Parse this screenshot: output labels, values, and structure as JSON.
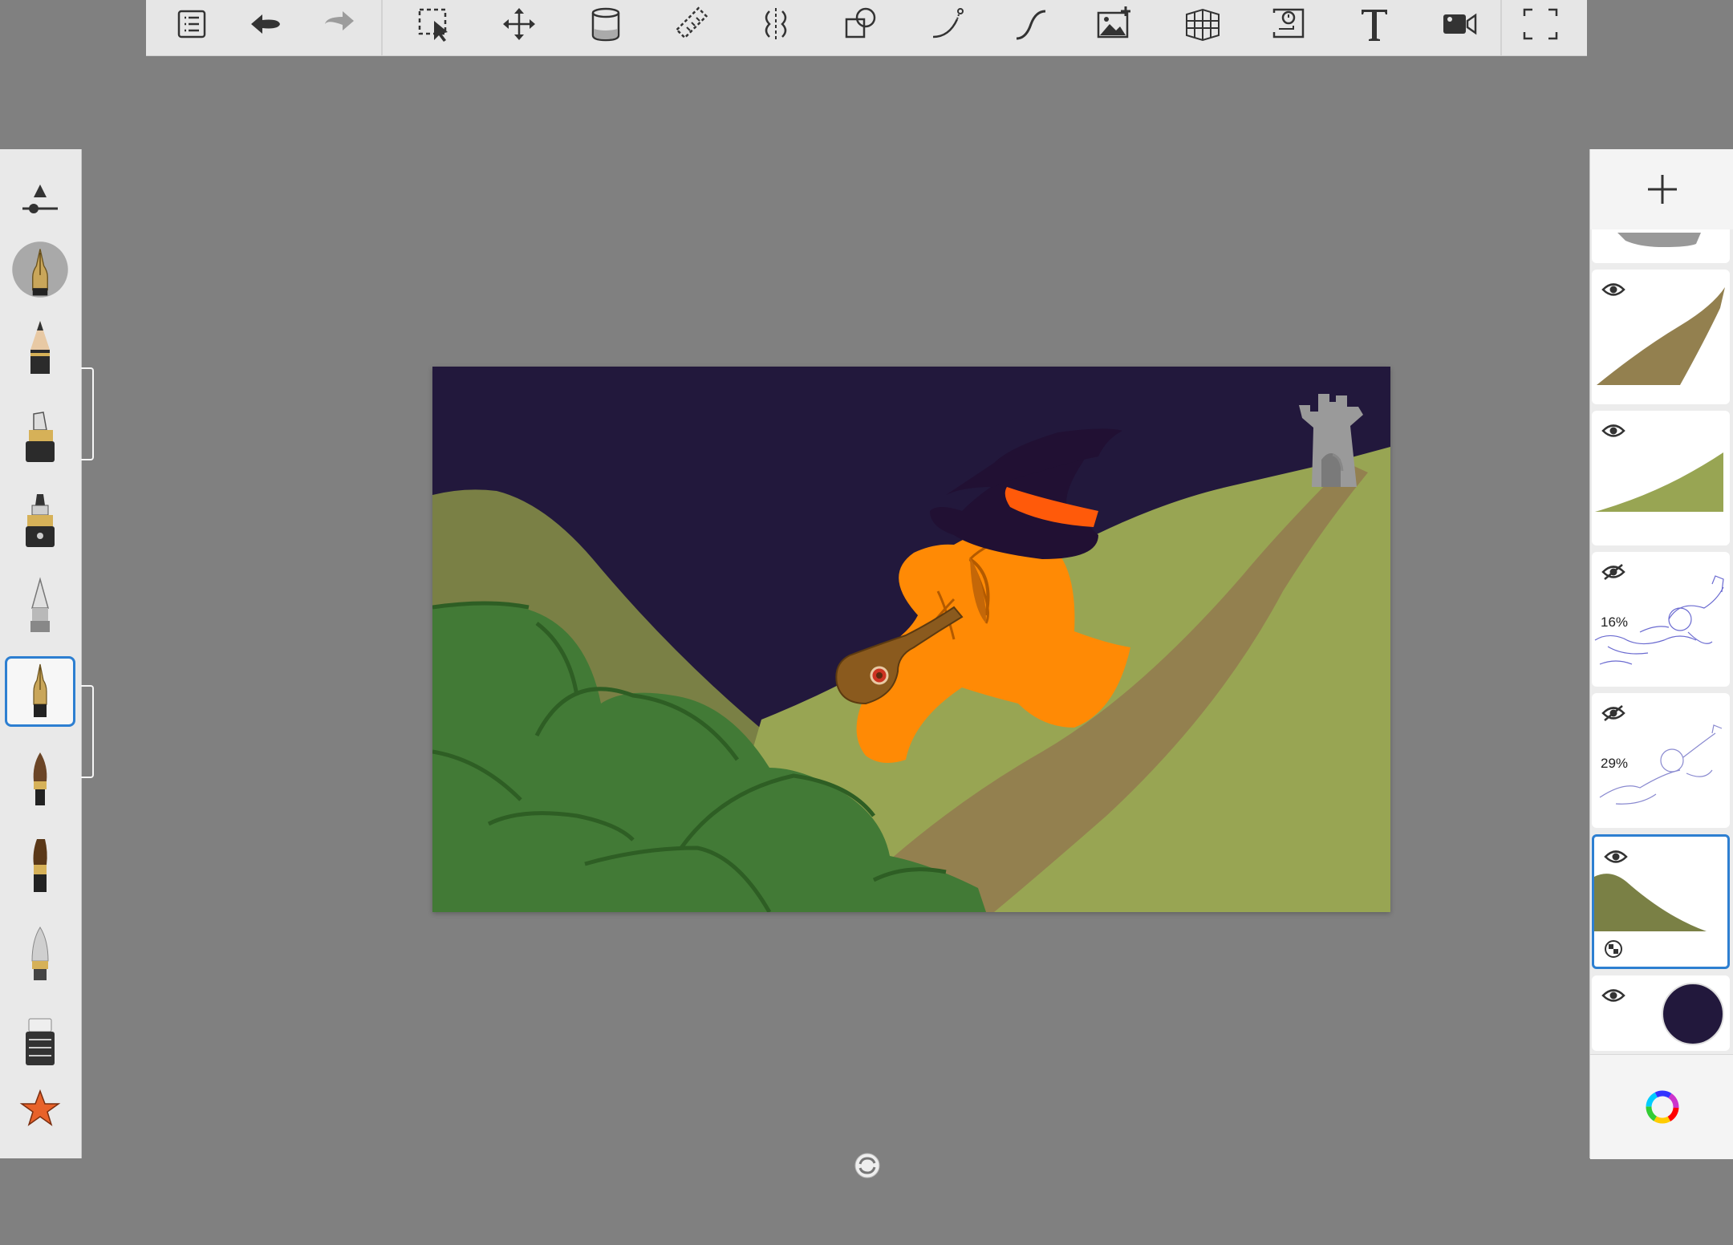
{
  "app": {
    "toolbar": {
      "tools": [
        "menu-icon",
        "undo-icon",
        "redo-icon",
        "selection-icon",
        "transform-icon",
        "fill-icon",
        "ruler-icon",
        "symmetry-icon",
        "shape-icon",
        "stroke-icon",
        "curve-icon",
        "add-image-icon",
        "perspective-icon",
        "time-lapse-icon",
        "text-icon",
        "record-icon",
        "fullscreen-icon"
      ]
    },
    "brushes": [
      "brush-properties",
      "ballpoint-pen",
      "pencil",
      "marker",
      "felt-pen",
      "airbrush",
      "inking-pen",
      "paint-brush",
      "flat-brush",
      "smudge",
      "eraser",
      "favorites-star"
    ],
    "selected_brush": "inking-pen"
  },
  "layers": [
    {
      "name": "castle",
      "visible": true,
      "opacity": ""
    },
    {
      "name": "path",
      "visible": true,
      "opacity": ""
    },
    {
      "name": "right-hill",
      "visible": true,
      "opacity": ""
    },
    {
      "name": "sketch-1",
      "visible": false,
      "opacity": "16%"
    },
    {
      "name": "sketch-2",
      "visible": false,
      "opacity": "29%"
    },
    {
      "name": "left-hill",
      "visible": true,
      "opacity": "",
      "selected": true
    },
    {
      "name": "background",
      "visible": true,
      "opacity": ""
    }
  ],
  "colors": {
    "sky": "#22183c",
    "dark_hill": "#7a8045",
    "light_hill": "#98a553",
    "path": "#93804f",
    "bush": "#427a36",
    "bush_line": "#2e5e24",
    "body": "#ff8a05",
    "hat": "#211033",
    "hat_band": "#ff5a0a",
    "castle": "#9a9a9a",
    "accent": "#2d7fd1"
  },
  "labels": {
    "opacity_16": "16%",
    "opacity_29": "29%"
  }
}
